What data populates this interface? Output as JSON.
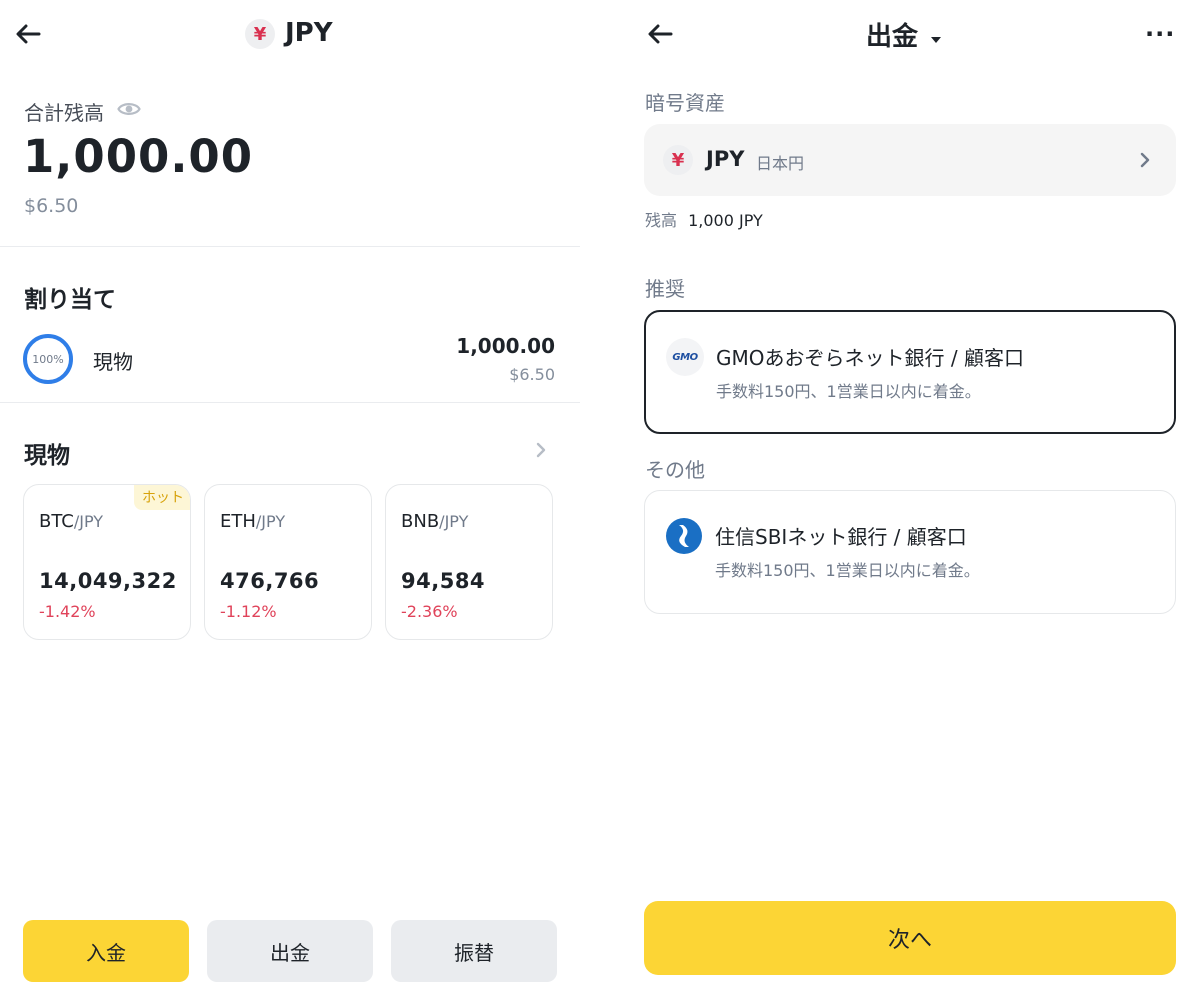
{
  "left": {
    "header": {
      "currency_symbol": "¥",
      "title": "JPY"
    },
    "balance": {
      "label": "合計残高",
      "amount": "1,000.00",
      "usd": "$6.50"
    },
    "allocation": {
      "title": "割り当て",
      "percent": "100%",
      "name": "現物",
      "amount": "1,000.00",
      "usd": "$6.50"
    },
    "spot": {
      "title": "現物",
      "markets": [
        {
          "base": "BTC",
          "quote": "/JPY",
          "price": "14,049,322",
          "change": "-1.42%",
          "badge": "ホット"
        },
        {
          "base": "ETH",
          "quote": "/JPY",
          "price": "476,766",
          "change": "-1.12%"
        },
        {
          "base": "BNB",
          "quote": "/JPY",
          "price": "94,584",
          "change": "-2.36%"
        }
      ]
    },
    "actions": {
      "deposit": "入金",
      "withdraw": "出金",
      "transfer": "振替"
    }
  },
  "right": {
    "header": {
      "title": "出金",
      "more": "···"
    },
    "asset": {
      "section_label": "暗号資産",
      "currency_symbol": "¥",
      "code": "JPY",
      "name": "日本円",
      "balance_label": "残高",
      "balance_value": "1,000 JPY"
    },
    "recommended": {
      "section_label": "推奨",
      "logo_text": "GMO",
      "bank_name": "GMOあおぞらネット銀行 / 顧客口",
      "desc": "手数料150円、1営業日以内に着金。"
    },
    "other": {
      "section_label": "その他",
      "bank_name": "住信SBIネット銀行 / 顧客口",
      "desc": "手数料150円、1営業日以内に着金。"
    },
    "next_button": "次へ"
  },
  "colors": {
    "accent_yellow": "#FCD535",
    "negative_red": "#E0435A",
    "ring_blue": "#2F7EE8",
    "muted_text": "#707A8A"
  }
}
